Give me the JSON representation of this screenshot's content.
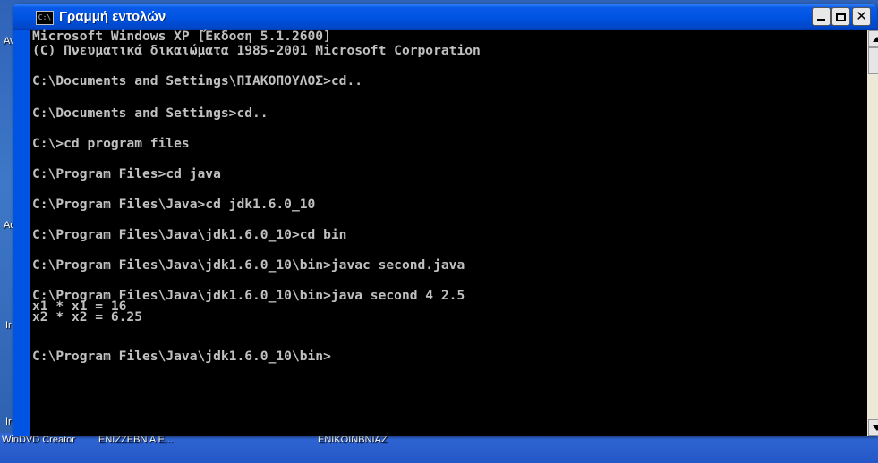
{
  "window": {
    "title": "Γραμμή εντολών",
    "icon": "command-prompt-icon",
    "accent": "#0054e3",
    "controls": [
      "minimize",
      "maximize",
      "close"
    ]
  },
  "desktop": {
    "labels": [
      "Ave",
      "Ado",
      "Ir",
      "Ir",
      "WinDVD Creator",
      "ENIZZEBN A E...",
      "ENIKOINBNIAZ"
    ]
  },
  "console": {
    "fg": "#c0c0c0",
    "bg": "#000000",
    "lines": [
      "Microsoft Windows XP [Έκδοση 5.1.2600]",
      "(C) Πνευματικά δικαιώματα 1985-2001 Microsoft Corporation",
      "",
      "C:\\Documents and Settings\\ΠΙΑΚΟΠΟΥΛΟΣ>cd..",
      "",
      "C:\\Documents and Settings>cd..",
      "",
      "C:\\>cd program files",
      "",
      "C:\\Program Files>cd java",
      "",
      "C:\\Program Files\\Java>cd jdk1.6.0_10",
      "",
      "C:\\Program Files\\Java\\jdk1.6.0_10>cd bin",
      "",
      "C:\\Program Files\\Java\\jdk1.6.0_10\\bin>javac second.java",
      "",
      "C:\\Program Files\\Java\\jdk1.6.0_10\\bin>java second 4 2.5",
      "x1 * x1 = 16",
      "x2 * x2 = 6.25",
      "",
      "C:\\Program Files\\Java\\jdk1.6.0_10\\bin>"
    ]
  }
}
